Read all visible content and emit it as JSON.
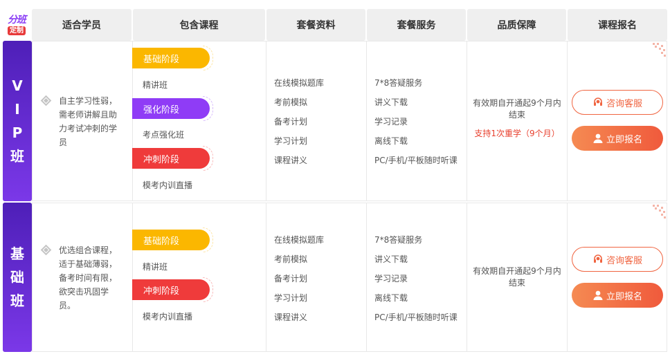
{
  "logo": {
    "line1": "分班",
    "line2": "定制"
  },
  "headers": [
    "适合学员",
    "包含课程",
    "套餐资料",
    "套餐服务",
    "品质保障",
    "课程报名"
  ],
  "rows": [
    {
      "side_chars": [
        "V",
        "I",
        "P",
        "班"
      ],
      "suitable": "自主学习性弱，需老师讲解且助力考试冲刺的学员",
      "stages": [
        {
          "label": "基础阶段",
          "color": "yellow",
          "course": "精讲班"
        },
        {
          "label": "强化阶段",
          "color": "purple",
          "course": "考点强化班"
        },
        {
          "label": "冲刺阶段",
          "color": "red",
          "course": "模考内训直播"
        }
      ],
      "materials": [
        "在线模拟题库",
        "考前模拟",
        "备考计划",
        "学习计划",
        "课程讲义"
      ],
      "services": [
        "7*8答疑服务",
        "讲义下载",
        "学习记录",
        "离线下载",
        "PC/手机/平板随时听课"
      ],
      "guarantee": "有效期自开通起9个月内结束",
      "guarantee_extra": "支持1次重学（9个月）",
      "consult_label": "咨询客服",
      "signup_label": "立即报名"
    },
    {
      "side_chars": [
        "基",
        "础",
        "班"
      ],
      "suitable": "优选组合课程，适于基础薄弱，备考时间有限，欲突击巩固学员。",
      "stages": [
        {
          "label": "基础阶段",
          "color": "yellow",
          "course": "精讲班"
        },
        {
          "label": "冲刺阶段",
          "color": "red",
          "course": "模考内训直播"
        }
      ],
      "materials": [
        "在线模拟题库",
        "考前模拟",
        "备考计划",
        "学习计划",
        "课程讲义"
      ],
      "services": [
        "7*8答疑服务",
        "讲义下载",
        "学习记录",
        "离线下载",
        "PC/手机/平板随时听课"
      ],
      "guarantee": "有效期自开通起9个月内结束",
      "consult_label": "咨询客服",
      "signup_label": "立即报名"
    }
  ],
  "colors": {
    "accent_purple": "#7b38e8",
    "accent_orange": "#f05a3c",
    "stage_yellow": "#fbb700",
    "stage_red": "#ef3b3b"
  }
}
